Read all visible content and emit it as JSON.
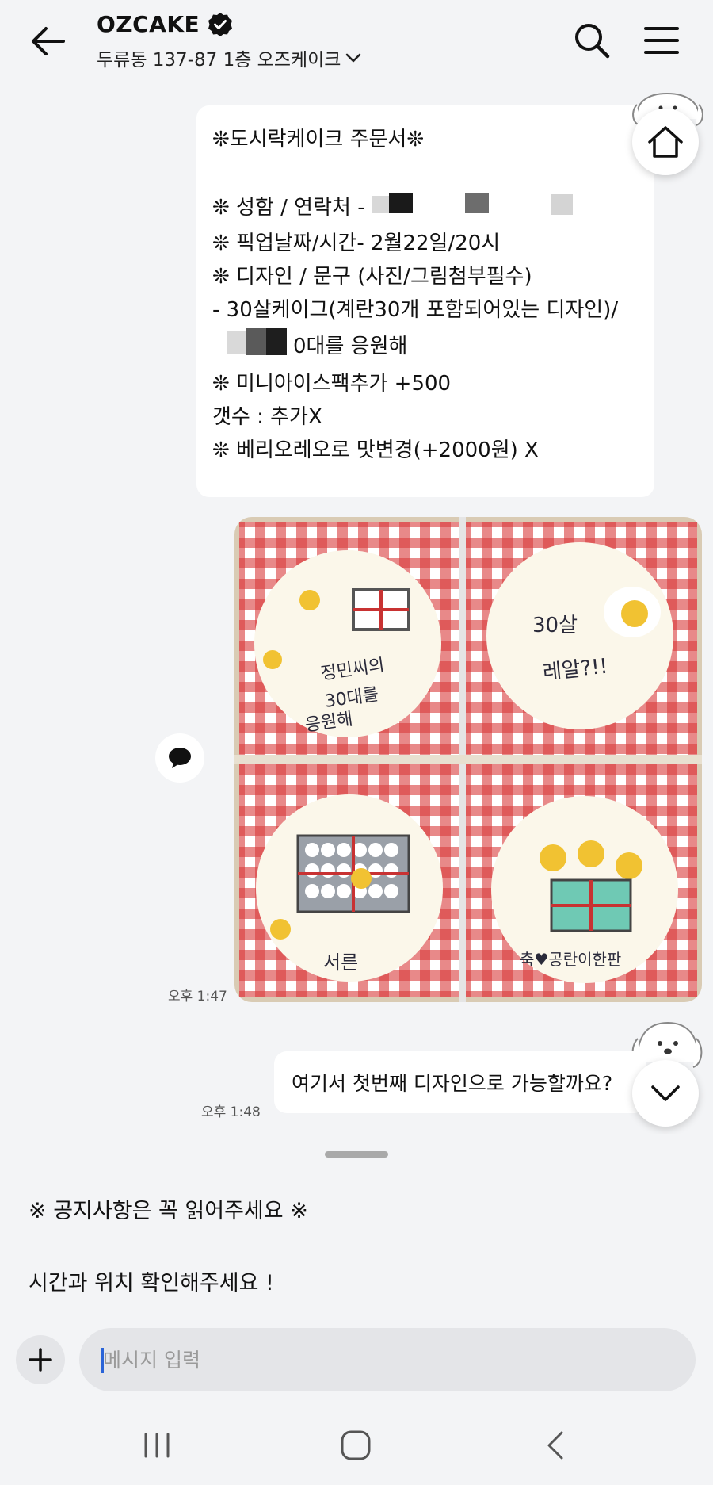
{
  "header": {
    "shop_name": "OZCAKE",
    "address": "두류동 137-87 1층 오즈케이크"
  },
  "order_form": {
    "lines": [
      "❊도시락케이크 주문서❊",
      "",
      "❊ 성함 / 연락처 - ",
      "❊ 픽업날짜/시간- 2월22일/20시",
      "❊ 디자인 / 문구 (사진/그림첨부필수)",
      "- 30살케이그(계란30개 포함되어있는 디자인)/",
      "0대를 응원해",
      "❊ 미니아이스팩추가 +500",
      "갯수 : 추가X",
      "❊ 베리오레오로 맛변경(+2000원) X"
    ]
  },
  "messages": [
    {
      "type": "image",
      "time": "오후 1:47"
    },
    {
      "type": "text",
      "text": "여기서 첫번째 디자인으로 가능할까요?",
      "time": "오후 1:48"
    }
  ],
  "notice": {
    "title": "※  공지사항은 꼭 읽어주세요 ※",
    "body": "시간과 위치 확인해주세요 !"
  },
  "input": {
    "placeholder": "메시지 입력"
  },
  "icons": {
    "back": "arrow-left-icon",
    "verified": "verified-badge-icon",
    "search": "search-icon",
    "menu": "hamburger-menu-icon",
    "home": "home-icon",
    "chat": "speech-bubble-icon",
    "scroll": "chevron-down-icon",
    "plus": "plus-icon"
  },
  "colors": {
    "background": "#f3f4f6",
    "bubble": "#ffffff",
    "caret": "#2a64d8"
  }
}
